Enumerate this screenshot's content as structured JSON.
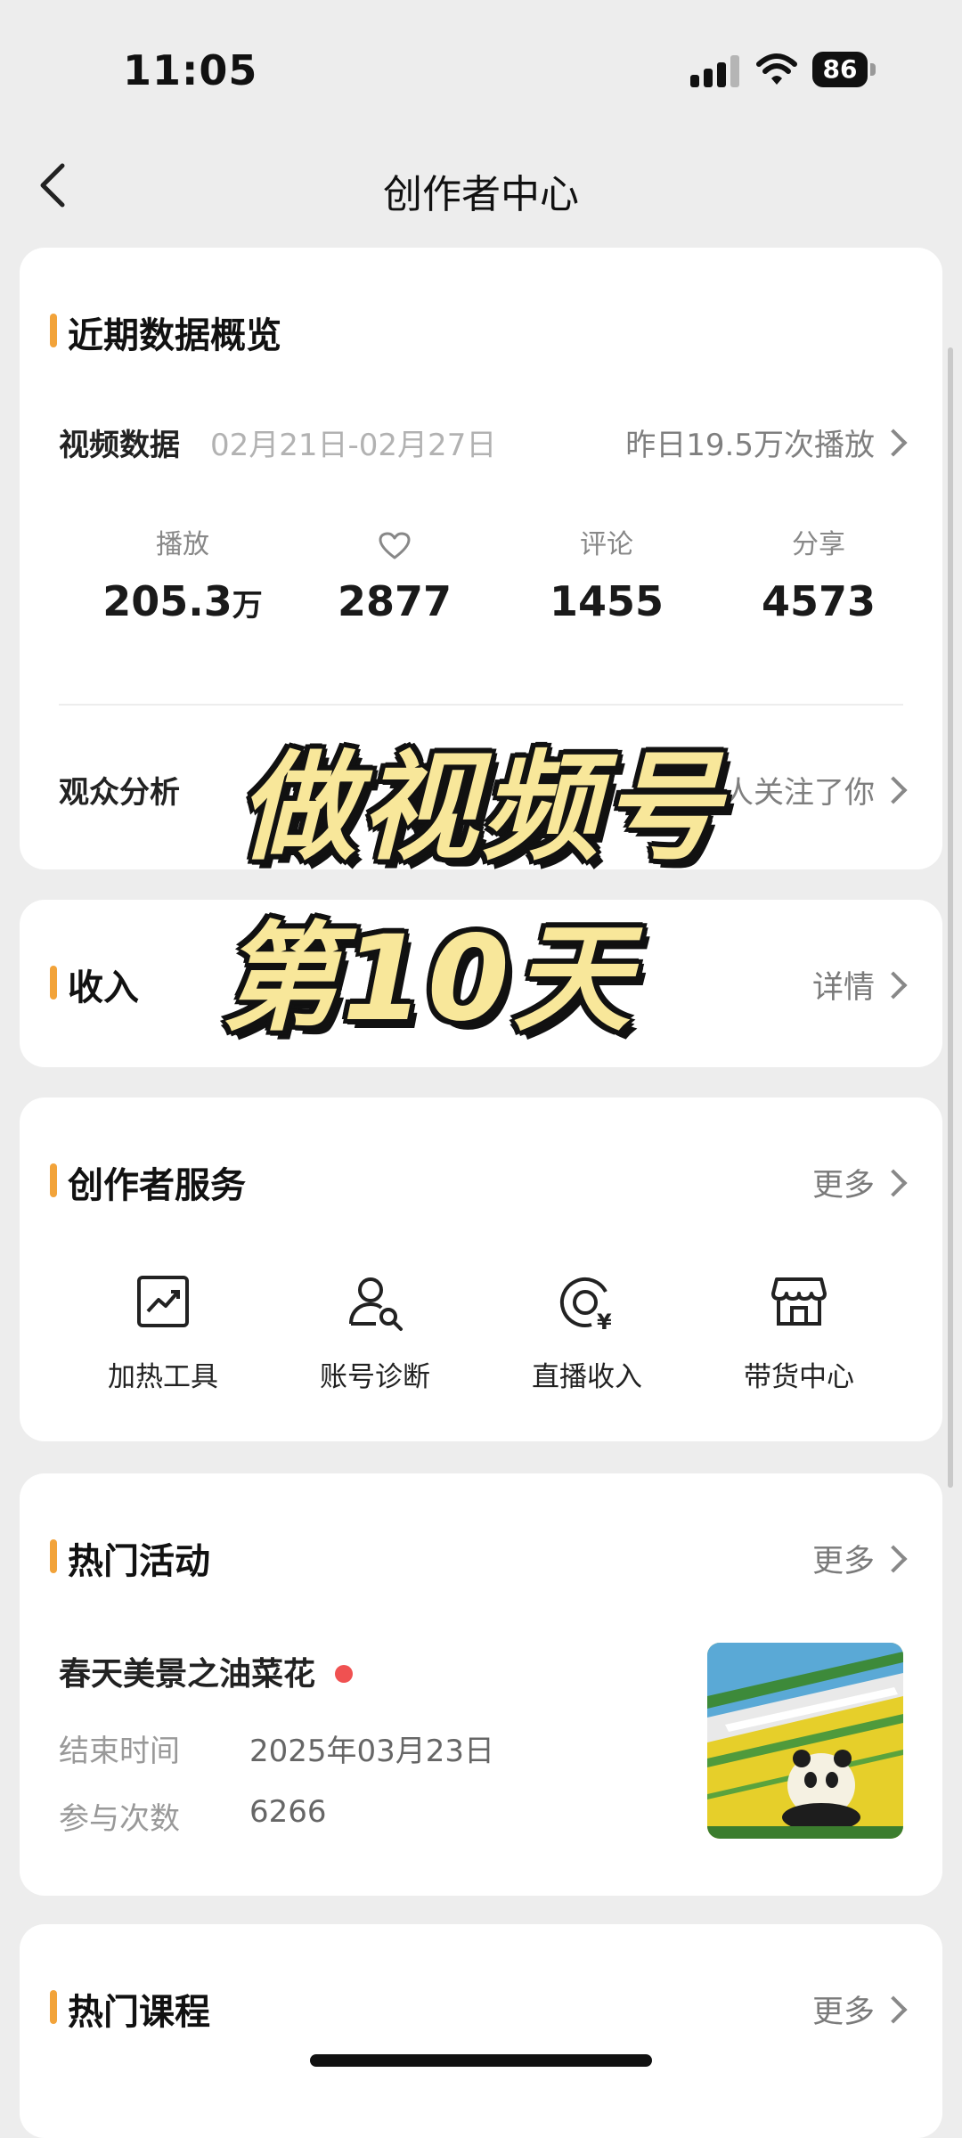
{
  "status": {
    "time": "11:05",
    "battery": "86"
  },
  "nav": {
    "title": "创作者中心"
  },
  "overview": {
    "title": "近期数据概览",
    "video_label": "视频数据",
    "date_range": "02月21日-02月27日",
    "yesterday_plays": "昨日19.5万次播放",
    "stats": [
      {
        "label": "播放",
        "value": "205.3",
        "unit": "万"
      },
      {
        "label": "",
        "icon": "heart-icon",
        "value": "2877"
      },
      {
        "label": "评论",
        "value": "1455"
      },
      {
        "label": "分享",
        "value": "4573"
      }
    ],
    "audience_label": "观众分析",
    "audience_right": "日77人关注了你"
  },
  "overlay": {
    "line1": "做视频号",
    "line2": "第10天"
  },
  "income": {
    "title": "收入",
    "detail": "详情"
  },
  "services": {
    "title": "创作者服务",
    "more": "更多",
    "items": [
      {
        "label": "加热工具",
        "icon": "trend-chart-icon"
      },
      {
        "label": "账号诊断",
        "icon": "user-search-icon"
      },
      {
        "label": "直播收入",
        "icon": "live-income-icon"
      },
      {
        "label": "带货中心",
        "icon": "store-icon"
      }
    ]
  },
  "activities": {
    "title": "热门活动",
    "more": "更多",
    "item": {
      "name": "春天美景之油菜花",
      "end_key": "结束时间",
      "end_value": "2025年03月23日",
      "count_key": "参与次数",
      "count_value": "6266"
    }
  },
  "courses": {
    "title": "热门课程",
    "more": "更多"
  }
}
